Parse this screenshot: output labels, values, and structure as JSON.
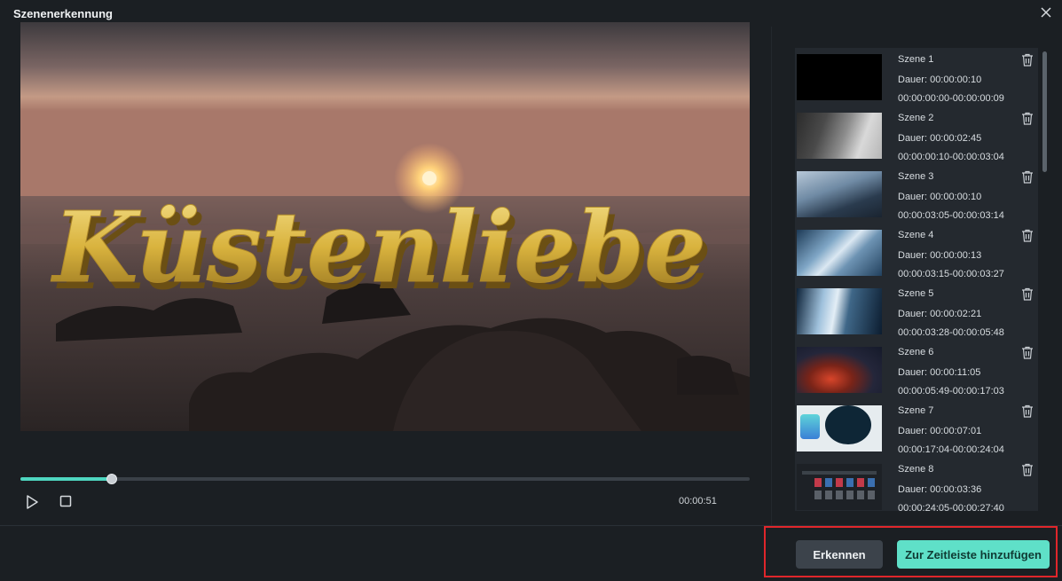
{
  "dialog": {
    "title": "Szenenerkennung",
    "close_icon": "close-icon"
  },
  "player": {
    "overlay_text": "Küstenliebe",
    "progress_fraction": 0.125,
    "timecode": "00:00:51",
    "play_icon": "play-icon",
    "stop_icon": "stop-icon"
  },
  "scenes": [
    {
      "name": "Szene 1",
      "duration": "Dauer: 00:00:00:10",
      "range": "00:00:00:00-00:00:00:09"
    },
    {
      "name": "Szene 2",
      "duration": "Dauer: 00:00:02:45",
      "range": "00:00:00:10-00:00:03:04"
    },
    {
      "name": "Szene 3",
      "duration": "Dauer: 00:00:00:10",
      "range": "00:00:03:05-00:00:03:14"
    },
    {
      "name": "Szene 4",
      "duration": "Dauer: 00:00:00:13",
      "range": "00:00:03:15-00:00:03:27"
    },
    {
      "name": "Szene 5",
      "duration": "Dauer: 00:00:02:21",
      "range": "00:00:03:28-00:00:05:48"
    },
    {
      "name": "Szene 6",
      "duration": "Dauer: 00:00:11:05",
      "range": "00:00:05:49-00:00:17:03"
    },
    {
      "name": "Szene 7",
      "duration": "Dauer: 00:00:07:01",
      "range": "00:00:17:04-00:00:24:04"
    },
    {
      "name": "Szene 8",
      "duration": "Dauer: 00:00:03:36",
      "range": "00:00:24:05-00:00:27:40"
    }
  ],
  "buttons": {
    "detect": "Erkennen",
    "add_to_timeline": "Zur Zeitleiste hinzufügen"
  },
  "colors": {
    "accent": "#5fe0c8",
    "highlight_border": "#e0262b",
    "background": "#1b1f23"
  }
}
